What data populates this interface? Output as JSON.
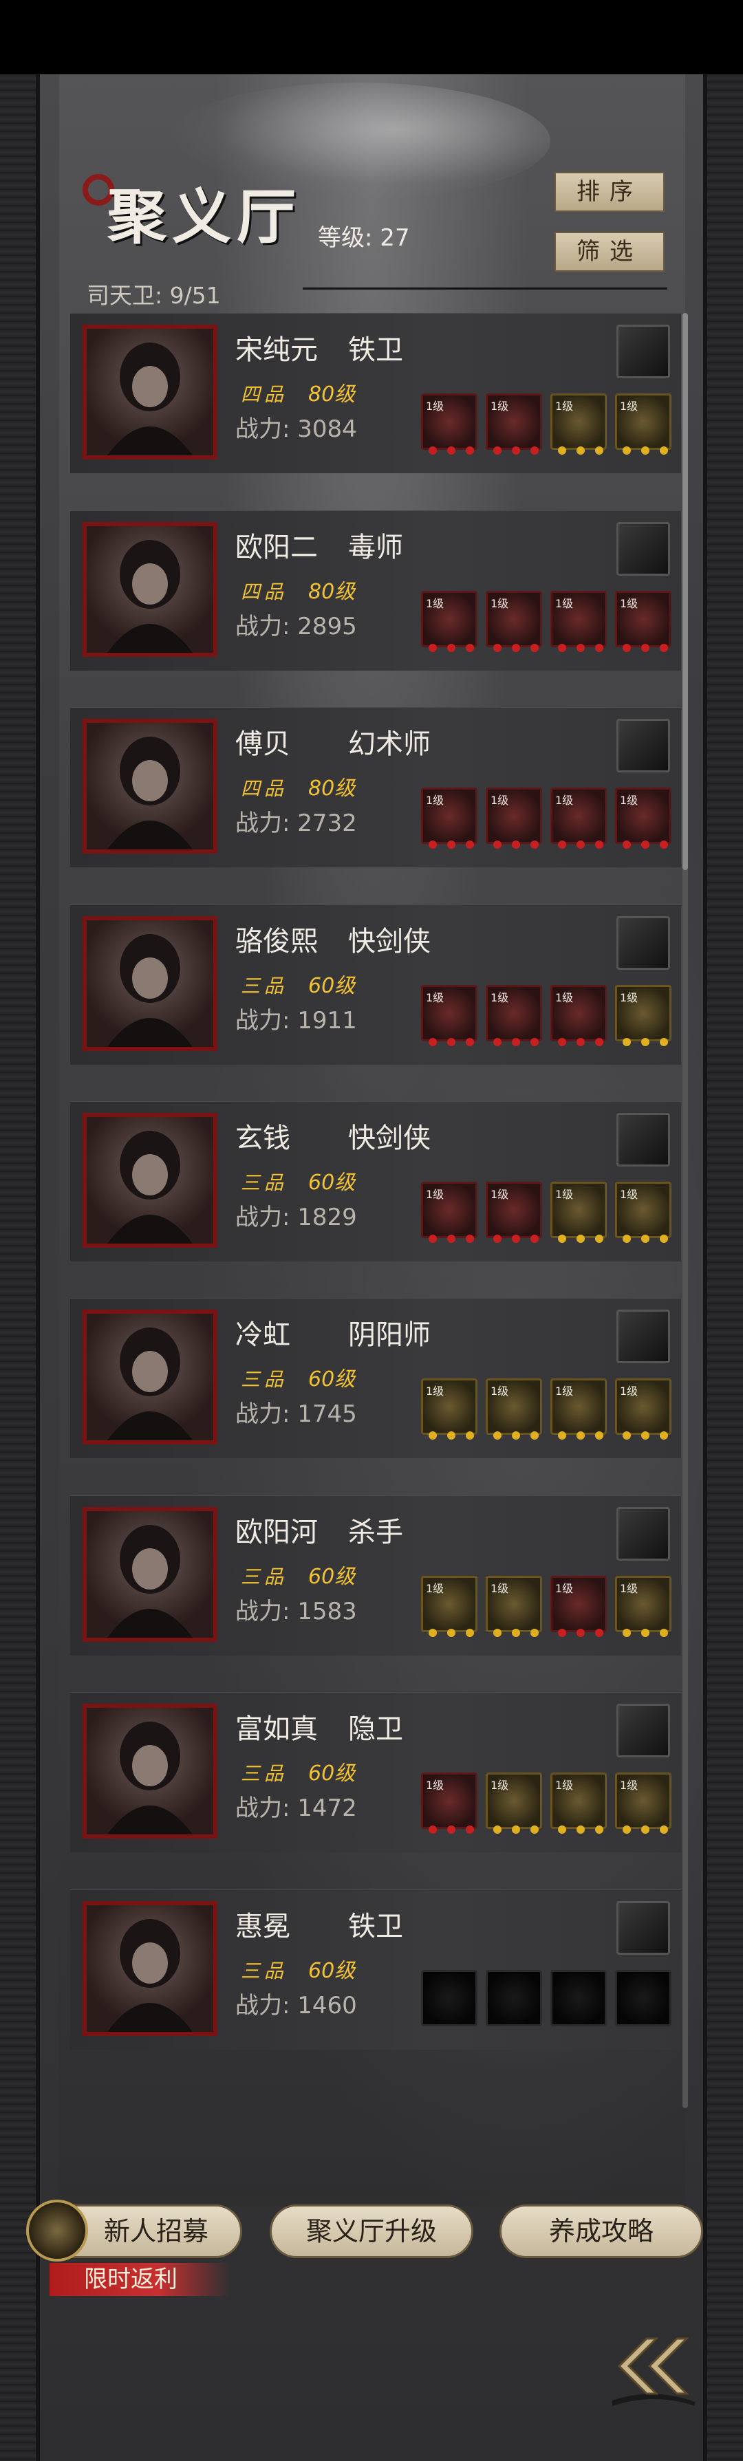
{
  "header": {
    "title": "聚义厅",
    "level_label": "等级: 27",
    "sort_label": "排序",
    "filter_label": "筛选",
    "guard_count": "司天卫: 9/51"
  },
  "heroes": [
    {
      "name": "宋纯元",
      "class": "铁卫",
      "rank": "四品",
      "level": "80级",
      "power": "战力: 3084",
      "slot_style": [
        "red",
        "red",
        "gold",
        "gold"
      ]
    },
    {
      "name": "欧阳二",
      "class": "毒师",
      "rank": "四品",
      "level": "80级",
      "power": "战力: 2895",
      "slot_style": [
        "red",
        "red",
        "red",
        "red"
      ]
    },
    {
      "name": "傅贝",
      "class": "幻术师",
      "rank": "四品",
      "level": "80级",
      "power": "战力: 2732",
      "slot_style": [
        "red",
        "red",
        "red",
        "red"
      ]
    },
    {
      "name": "骆俊熙",
      "class": "快剑侠",
      "rank": "三品",
      "level": "60级",
      "power": "战力: 1911",
      "slot_style": [
        "red",
        "red",
        "red",
        "gold"
      ]
    },
    {
      "name": "玄钱",
      "class": "快剑侠",
      "rank": "三品",
      "level": "60级",
      "power": "战力: 1829",
      "slot_style": [
        "red",
        "red",
        "gold",
        "gold"
      ]
    },
    {
      "name": "冷虹",
      "class": "阴阳师",
      "rank": "三品",
      "level": "60级",
      "power": "战力: 1745",
      "slot_style": [
        "gold",
        "gold",
        "gold",
        "gold"
      ]
    },
    {
      "name": "欧阳河",
      "class": "杀手",
      "rank": "三品",
      "level": "60级",
      "power": "战力: 1583",
      "slot_style": [
        "gold",
        "gold",
        "red",
        "gold"
      ]
    },
    {
      "name": "富如真",
      "class": "隐卫",
      "rank": "三品",
      "level": "60级",
      "power": "战力: 1472",
      "slot_style": [
        "red",
        "gold",
        "gold",
        "gold"
      ]
    },
    {
      "name": "惠冕",
      "class": "铁卫",
      "rank": "三品",
      "level": "60级",
      "power": "战力: 1460",
      "slot_style": [
        "empty",
        "empty",
        "empty",
        "empty"
      ]
    }
  ],
  "equip_tag": "1级",
  "bottom": {
    "recruit_label": "新人招募",
    "upgrade_label": "聚义厅升级",
    "guide_label": "养成攻略",
    "promo_label": "限时返利"
  },
  "colors": {
    "rank_gold": "#f3c233",
    "portrait_border": "#7a1414",
    "button_bg": "#d8cbb0"
  }
}
